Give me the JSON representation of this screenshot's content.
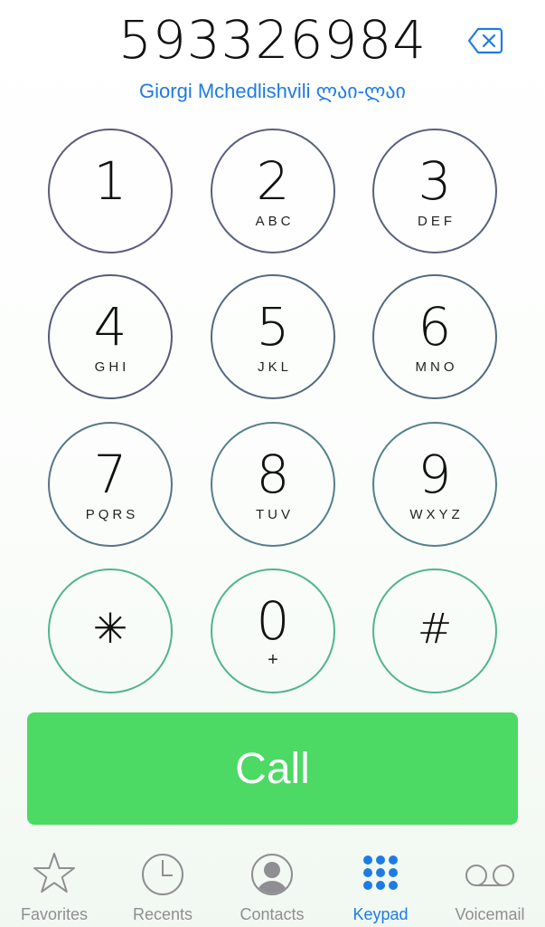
{
  "dialer": {
    "number": "593326984",
    "contact_name": "Giorgi Mchedlishvili ლაი-ლაი"
  },
  "keypad": {
    "keys": [
      {
        "digit": "1",
        "letters": ""
      },
      {
        "digit": "2",
        "letters": "ABC"
      },
      {
        "digit": "3",
        "letters": "DEF"
      },
      {
        "digit": "4",
        "letters": "GHI"
      },
      {
        "digit": "5",
        "letters": "JKL"
      },
      {
        "digit": "6",
        "letters": "MNO"
      },
      {
        "digit": "7",
        "letters": "PQRS"
      },
      {
        "digit": "8",
        "letters": "TUV"
      },
      {
        "digit": "9",
        "letters": "WXYZ"
      },
      {
        "digit": "✳",
        "letters": ""
      },
      {
        "digit": "0",
        "letters": "+"
      },
      {
        "digit": "#",
        "letters": ""
      }
    ]
  },
  "call_button": {
    "label": "Call"
  },
  "tabbar": {
    "tabs": [
      {
        "label": "Favorites",
        "icon": "star-icon"
      },
      {
        "label": "Recents",
        "icon": "clock-icon"
      },
      {
        "label": "Contacts",
        "icon": "person-icon"
      },
      {
        "label": "Keypad",
        "icon": "keypad-icon",
        "active": true
      },
      {
        "label": "Voicemail",
        "icon": "voicemail-icon"
      }
    ]
  },
  "colors": {
    "accent": "#1e7be6",
    "call_green": "#4cd964",
    "tab_inactive": "#8e8e93",
    "key_ring_top": "#5a5a7a",
    "key_ring_bottom": "#4dbb8f"
  }
}
